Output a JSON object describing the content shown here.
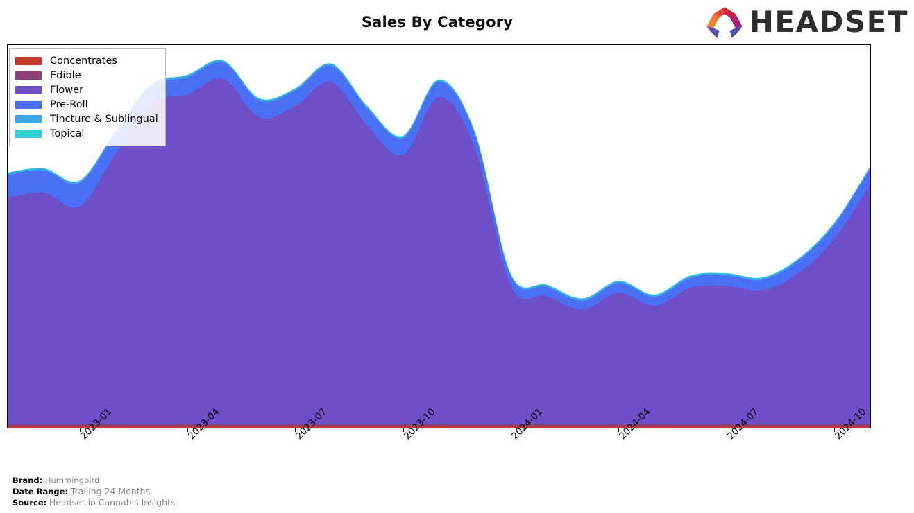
{
  "header": {
    "title": "Sales By Category",
    "logo": {
      "wordmark": "HEADSET",
      "mark_name": "headset-hexagon-logo",
      "mark_colors": [
        "#f07c2a",
        "#e03a3a",
        "#cf2050",
        "#b81b6e",
        "#7b3f9e",
        "#3f51b5",
        "#4256c4"
      ]
    }
  },
  "legend": {
    "position": "upper-left",
    "items": [
      {
        "label": "Concentrates",
        "color": "#c0392b"
      },
      {
        "label": "Edible",
        "color": "#8e3f78"
      },
      {
        "label": "Flower",
        "color": "#6f4fc8"
      },
      {
        "label": "Pre-Roll",
        "color": "#4a70f5"
      },
      {
        "label": "Tincture & Sublingual",
        "color": "#3aa8e8"
      },
      {
        "label": "Topical",
        "color": "#2fd0d0"
      }
    ]
  },
  "footer": {
    "rows": [
      {
        "key": "Brand:",
        "value": "Hummingbird"
      },
      {
        "key": "Date Range:",
        "value": "Trailing 24 Months"
      },
      {
        "key": "Source:",
        "value": "Headset.io Cannabis Insights"
      }
    ]
  },
  "chart_data": {
    "type": "area",
    "stacked": true,
    "title": "Sales By Category",
    "xlabel": "",
    "ylabel": "",
    "grid": false,
    "legend_position": "upper left",
    "smoothing": "spline",
    "axis_tick_rotation": -45,
    "x": [
      "2022-11",
      "2022-12",
      "2023-01",
      "2023-02",
      "2023-03",
      "2023-04",
      "2023-05",
      "2023-06",
      "2023-07",
      "2023-08",
      "2023-09",
      "2023-10",
      "2023-11",
      "2023-12",
      "2024-01",
      "2024-02",
      "2024-03",
      "2024-04",
      "2024-05",
      "2024-06",
      "2024-07",
      "2024-08",
      "2024-09",
      "2024-10",
      "2024-11"
    ],
    "xticks": [
      "2023-01",
      "2023-04",
      "2023-07",
      "2023-10",
      "2024-01",
      "2024-04",
      "2024-07",
      "2024-10"
    ],
    "xtick_positions": [
      2,
      5,
      8,
      11,
      14,
      17,
      20,
      23
    ],
    "ylim": [
      0,
      100
    ],
    "series": [
      {
        "name": "Concentrates",
        "color": "#c0392b",
        "values": [
          0.4,
          0.4,
          0.4,
          0.4,
          0.4,
          0.4,
          0.4,
          0.4,
          0.4,
          0.4,
          0.4,
          0.4,
          0.4,
          0.4,
          0.4,
          0.4,
          0.4,
          0.4,
          0.4,
          0.4,
          0.4,
          0.4,
          0.4,
          0.4,
          0.4
        ]
      },
      {
        "name": "Edible",
        "color": "#8e3f78",
        "values": [
          0.5,
          0.5,
          0.5,
          0.5,
          0.5,
          0.5,
          0.5,
          0.5,
          0.5,
          0.5,
          0.5,
          0.5,
          0.5,
          0.5,
          0.5,
          0.5,
          0.5,
          0.5,
          0.5,
          0.5,
          0.5,
          0.5,
          0.5,
          0.5,
          0.5
        ]
      },
      {
        "name": "Flower",
        "color": "#6f4fc8",
        "values": [
          59.2,
          60.5,
          57.0,
          70.6,
          84.0,
          86.2,
          90.3,
          80.2,
          83.2,
          89.5,
          78.1,
          70.4,
          85.5,
          72.2,
          36.1,
          33.5,
          30.0,
          34.4,
          31.0,
          35.7,
          36.2,
          35.0,
          39.5,
          48.5,
          62.8
        ]
      },
      {
        "name": "Pre-Roll",
        "color": "#4a70f5",
        "values": [
          6.0,
          5.8,
          6.1,
          5.4,
          4.3,
          4.5,
          4.2,
          4.4,
          4.0,
          4.2,
          4.5,
          4.4,
          4.0,
          3.6,
          2.6,
          2.4,
          2.3,
          2.5,
          2.3,
          2.6,
          2.7,
          2.8,
          3.2,
          3.6,
          4.0
        ]
      },
      {
        "name": "Tincture & Sublingual",
        "color": "#3aa8e8",
        "values": [
          0.45,
          0.45,
          0.45,
          0.45,
          0.45,
          0.45,
          0.45,
          0.45,
          0.45,
          0.45,
          0.45,
          0.45,
          0.45,
          0.45,
          0.45,
          0.45,
          0.45,
          0.45,
          0.45,
          0.45,
          0.45,
          0.45,
          0.45,
          0.45,
          0.45
        ]
      },
      {
        "name": "Topical",
        "color": "#2fd0d0",
        "values": [
          0.15,
          0.15,
          0.15,
          0.15,
          0.15,
          0.15,
          0.15,
          0.15,
          0.15,
          0.15,
          0.15,
          0.15,
          0.15,
          0.15,
          0.15,
          0.15,
          0.15,
          0.15,
          0.15,
          0.15,
          0.15,
          0.15,
          0.15,
          0.15,
          0.15
        ]
      }
    ]
  }
}
